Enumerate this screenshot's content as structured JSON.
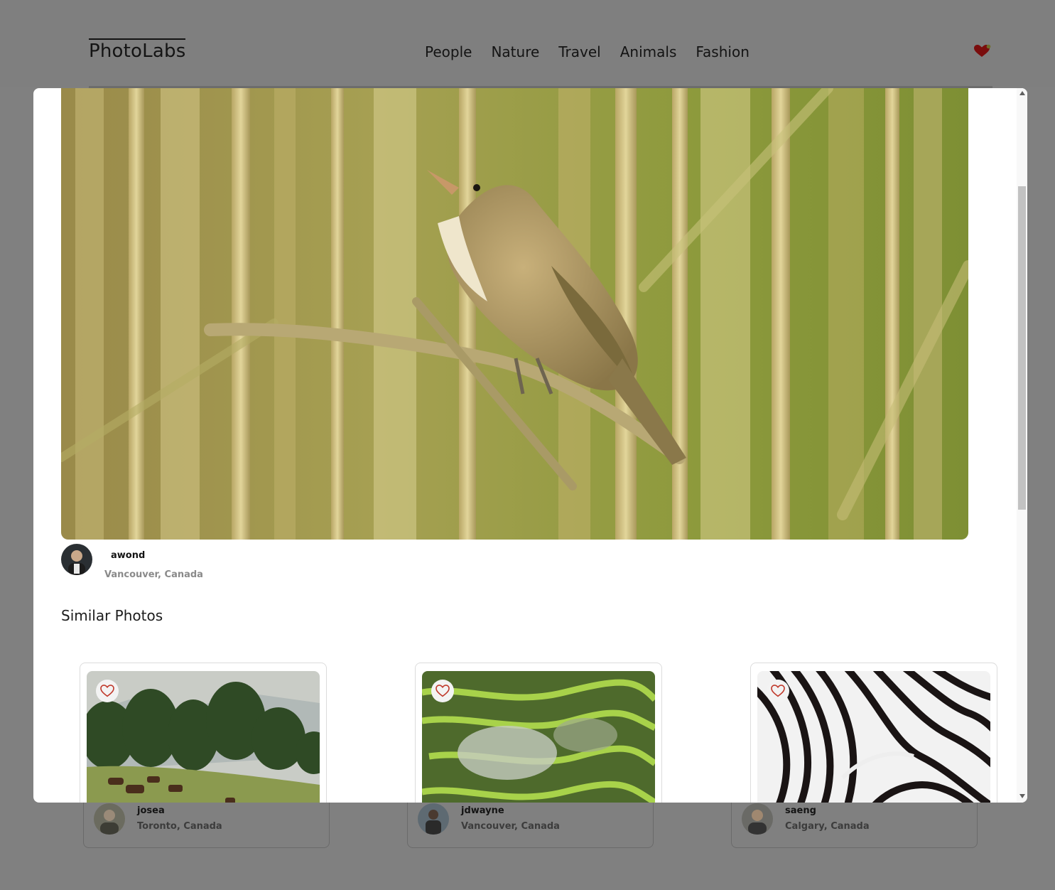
{
  "app": {
    "title": "PhotoLabs"
  },
  "nav": {
    "items": [
      "People",
      "Nature",
      "Travel",
      "Animals",
      "Fashion"
    ]
  },
  "header": {
    "fav_icon": "heart-icon",
    "fav_color": "#b30b0b"
  },
  "modal": {
    "photo_subject": "bird",
    "author": {
      "name": "awond",
      "location": "Vancouver, Canada"
    },
    "similar_title": "Similar Photos",
    "similar": [
      {
        "name": "josea",
        "location": "Toronto, Canada",
        "subject": "horses"
      },
      {
        "name": "jdwayne",
        "location": "Vancouver, Canada",
        "subject": "rice-terraces"
      },
      {
        "name": "saeng",
        "location": "Calgary, Canada",
        "subject": "zebra"
      }
    ]
  },
  "colors": {
    "fav_stroke": "#c0392b",
    "overlay": "#808080"
  }
}
